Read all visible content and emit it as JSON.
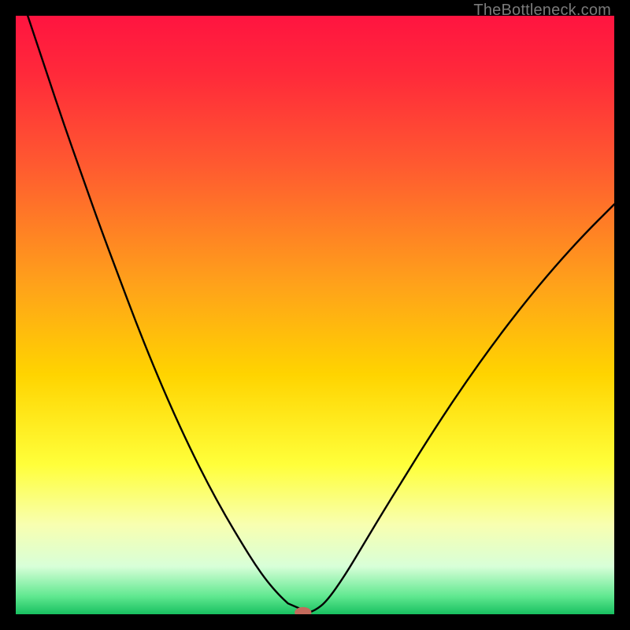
{
  "watermark": {
    "text": "TheBottleneck.com"
  },
  "chart_data": {
    "type": "line",
    "title": "",
    "xlabel": "",
    "ylabel": "",
    "xlim": [
      0,
      100
    ],
    "ylim": [
      0,
      100
    ],
    "grid": false,
    "legend": false,
    "gradient_stops": [
      {
        "offset": 0.0,
        "color": "#ff1440"
      },
      {
        "offset": 0.1,
        "color": "#ff2a3a"
      },
      {
        "offset": 0.25,
        "color": "#ff5a30"
      },
      {
        "offset": 0.45,
        "color": "#ffa21a"
      },
      {
        "offset": 0.6,
        "color": "#ffd400"
      },
      {
        "offset": 0.75,
        "color": "#ffff3a"
      },
      {
        "offset": 0.85,
        "color": "#f8ffb0"
      },
      {
        "offset": 0.92,
        "color": "#d8ffd8"
      },
      {
        "offset": 0.97,
        "color": "#60e890"
      },
      {
        "offset": 1.0,
        "color": "#18c060"
      }
    ],
    "series": [
      {
        "name": "bottleneck-curve",
        "color": "#000000",
        "x": [
          2,
          5,
          8,
          11,
          14,
          17,
          20,
          23,
          26,
          29,
          32,
          35,
          38,
          40,
          42,
          44,
          45.5,
          47,
          49,
          50,
          52,
          55,
          58,
          61,
          65,
          70,
          75,
          80,
          85,
          90,
          95,
          100
        ],
        "y": [
          100,
          91,
          82,
          73.5,
          65,
          57,
          49,
          41.5,
          34.5,
          28,
          22,
          16.5,
          11.5,
          8.3,
          5.5,
          3.2,
          1.8,
          0.8,
          0.3,
          0.6,
          2.2,
          6.5,
          11.5,
          16.5,
          23,
          31,
          38.5,
          45.5,
          52,
          58,
          63.5,
          68.5
        ]
      }
    ],
    "flat_bottom": {
      "x_start": 45.5,
      "x_end": 49,
      "y": 0.3
    },
    "marker": {
      "x": 48,
      "y": 0.3,
      "rx": 1.4,
      "ry": 0.9,
      "color": "#c46a5c"
    }
  }
}
